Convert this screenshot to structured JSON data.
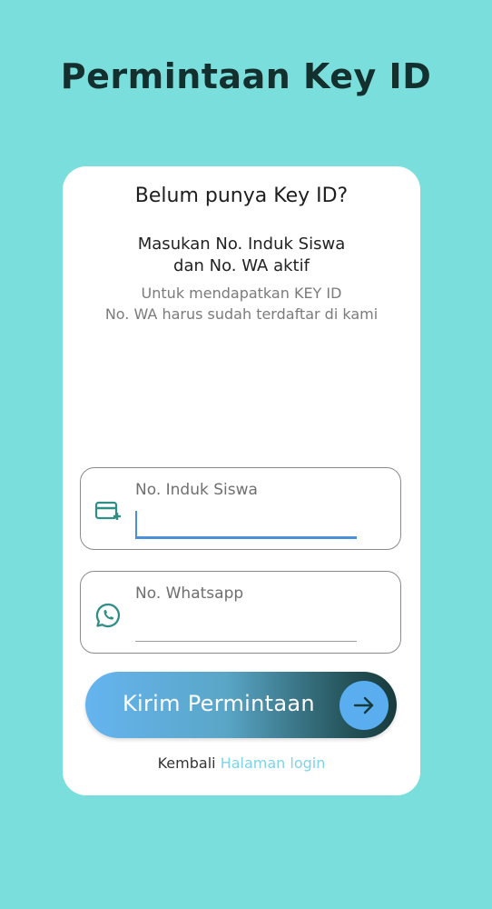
{
  "page": {
    "title": "Permintaan Key ID"
  },
  "card": {
    "heading": "Belum punya Key ID?",
    "instruction_line1": "Masukan No. Induk Siswa",
    "instruction_line2": "dan No. WA aktif",
    "note_line1": "Untuk mendapatkan KEY ID",
    "note_line2": "No. WA harus sudah terdaftar di kami"
  },
  "form": {
    "nis": {
      "label": "No. Induk Siswa",
      "value": "",
      "icon": "add-card-icon"
    },
    "whatsapp": {
      "label": "No. Whatsapp",
      "value": "",
      "icon": "whatsapp-icon"
    }
  },
  "submit": {
    "label": "Kirim Permintaan",
    "icon": "arrow-right-icon"
  },
  "footer": {
    "back_text": "Kembali",
    "login_link": "Halaman login"
  },
  "colors": {
    "background": "#7adfdc",
    "title": "#14302e",
    "accent_blue": "#4a90d9",
    "icon_teal": "#2f8f86",
    "link": "#7fd3e6",
    "button_gradient_start": "#65b4ef",
    "button_gradient_end": "#183a3c"
  }
}
